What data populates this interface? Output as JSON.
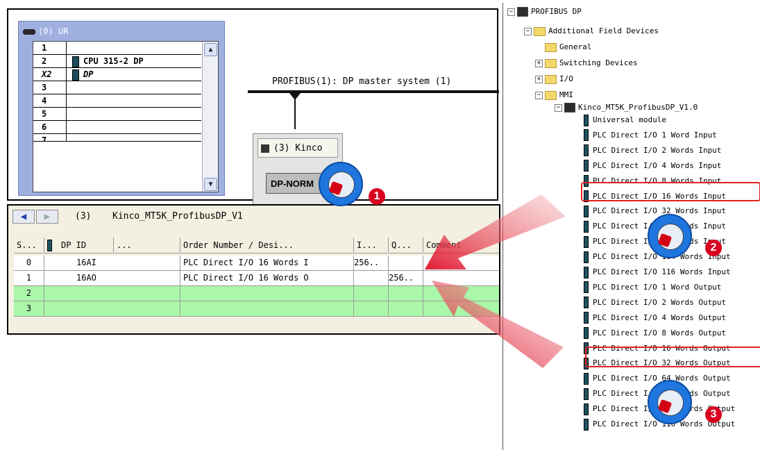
{
  "hardware": {
    "rack_title": "(0) UR",
    "rows": [
      {
        "slot": "1",
        "module": ""
      },
      {
        "slot": "2",
        "module": "CPU 315-2 DP"
      },
      {
        "slot": "X2",
        "module": "DP"
      },
      {
        "slot": "3",
        "module": ""
      },
      {
        "slot": "4",
        "module": ""
      },
      {
        "slot": "5",
        "module": ""
      },
      {
        "slot": "6",
        "module": ""
      },
      {
        "slot": "7",
        "module": ""
      }
    ],
    "bus_label": "PROFIBUS(1): DP master system (1)",
    "station_head": "(3) Kinco",
    "station_body": "DP-NORM"
  },
  "detail": {
    "slot": "(3)",
    "name": "Kinco_MT5K_ProfibusDP_V1",
    "headers": [
      "S...",
      "DP ID",
      "...",
      "Order Number / Desi...",
      "I...",
      "Q...",
      "Comment"
    ],
    "rows": [
      {
        "s": "0",
        "dpid": "16AI",
        "order": "PLC Direct I/O 16 Words I",
        "i": "256..",
        "q": ""
      },
      {
        "s": "1",
        "dpid": "16AO",
        "order": "PLC Direct I/O 16 Words O",
        "i": "",
        "q": "256.."
      },
      {
        "s": "2",
        "dpid": "",
        "order": "",
        "i": "",
        "q": ""
      },
      {
        "s": "3",
        "dpid": "",
        "order": "",
        "i": "",
        "q": ""
      }
    ]
  },
  "tree": {
    "root": "PROFIBUS DP",
    "additional": "Additional Field Devices",
    "general": "General",
    "switching": "Switching Devices",
    "io": "I/O",
    "mmi": "MMI",
    "device": "Kinco_MT5K_ProfibusDP_V1.0",
    "items": [
      "Universal module",
      "PLC Direct I/O 1 Word Input",
      "PLC Direct I/O 2 Words Input",
      "PLC Direct I/O 4 Words Input",
      "PLC Direct I/O 8 Words Input",
      "PLC Direct I/O 16 Words Input",
      "PLC Direct I/O 32 Words Input",
      "PLC Direct I/O 64 Words Input",
      "PLC Direct I/O 96 Words Input",
      "PLC Direct I/O 104 Words Input",
      "PLC Direct I/O 116 Words Input",
      "PLC Direct I/O 1 Word Output",
      "PLC Direct I/O 2 Words Output",
      "PLC Direct I/O 4 Words Output",
      "PLC Direct I/O 8 Words Output",
      "PLC Direct I/O 16 Words Output",
      "PLC Direct I/O 32 Words Output",
      "PLC Direct I/O 64 Words Output",
      "PLC Direct I/O 96 Words Output",
      "PLC Direct I/O 104 Words Output",
      "PLC Direct I/O 116 Words Output"
    ]
  },
  "callouts": [
    "1",
    "2",
    "3"
  ],
  "colors": {
    "highlight": "#e02020",
    "callout_blue": "#1e76de",
    "badge_red": "#d8001e",
    "empty_row_green": "#aaf7a9"
  }
}
